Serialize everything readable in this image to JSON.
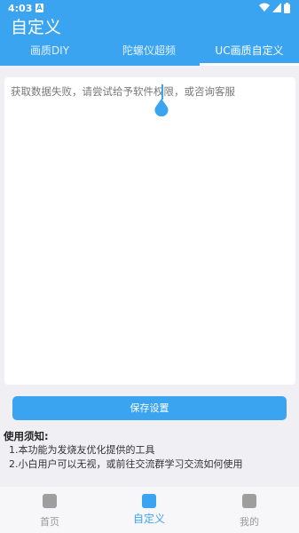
{
  "status_bar": {
    "time": "4:03",
    "notification_letter": "A"
  },
  "app_title": "自定义",
  "tabs": [
    {
      "label": "画质DIY",
      "active": false
    },
    {
      "label": "陀螺仪超频",
      "active": false
    },
    {
      "label": "UC画质自定义",
      "active": true
    }
  ],
  "editor": {
    "text": "获取数据失败，请尝试给予软件权限，或咨询客服"
  },
  "save_button": "保存设置",
  "notes": {
    "heading": "使用须知:",
    "lines": [
      "1.本功能为发烧友优化提供的工具",
      "2.小白用户可以无视，或前往交流群学习交流如何使用"
    ]
  },
  "bottom_nav": [
    {
      "label": "首页",
      "icon": "home-icon",
      "active": false
    },
    {
      "label": "自定义",
      "icon": "custom-icon",
      "active": true
    },
    {
      "label": "我的",
      "icon": "profile-icon",
      "active": false
    }
  ],
  "colors": {
    "accent": "#3aa4f1",
    "background": "#f0eff4"
  }
}
